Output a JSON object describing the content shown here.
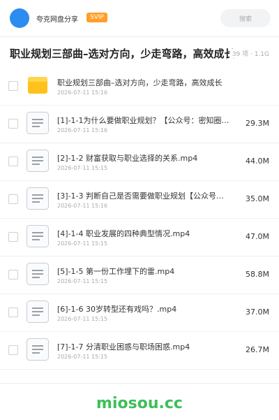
{
  "header": {
    "user_name": "夸克网盘分享",
    "badge": "SVIP",
    "search_placeholder": "搜索",
    "avatar_color": "#2d8cf0"
  },
  "folder": {
    "title": "职业规划三部曲–选对方向，少走弯路，高效成长",
    "meta": "39 项 · 1.1G"
  },
  "items": [
    {
      "type": "folder",
      "name": "职业规划三部曲–选对方向，少走弯路，高效成长",
      "date": "2026-07-11 15:16",
      "size": ""
    },
    {
      "type": "video",
      "name": "[1]-1-1为什么要做职业规划？【公众号：密知圈…",
      "date": "2026-07-11 15:16",
      "size": "29.3M"
    },
    {
      "type": "video",
      "name": "[2]-1-2 财富获取与职业选择的关系.mp4",
      "date": "2026-07-11 15:15",
      "size": "44.0M"
    },
    {
      "type": "video",
      "name": "[3]-1-3 判断自己是否需要做职业规划【公众号…",
      "date": "2026-07-11 15:16",
      "size": "35.0M"
    },
    {
      "type": "video",
      "name": "[4]-1-4 职业发展的四种典型情况.mp4",
      "date": "2026-07-11 15:15",
      "size": "47.0M"
    },
    {
      "type": "video",
      "name": "[5]-1-5 第一份工作埋下的雷.mp4",
      "date": "2026-07-11 15:15",
      "size": "58.8M"
    },
    {
      "type": "video",
      "name": "[6]-1-6 30岁转型还有戏吗？.mp4",
      "date": "2026-07-11 15:15",
      "size": "37.0M"
    },
    {
      "type": "video",
      "name": "[7]-1-7 分清职业困惑与职场困惑.mp4",
      "date": "2026-07-11 15:15",
      "size": "26.7M"
    }
  ],
  "footer": {
    "watermark": "miosou.cc",
    "watermark_color": "#3cbf58"
  }
}
